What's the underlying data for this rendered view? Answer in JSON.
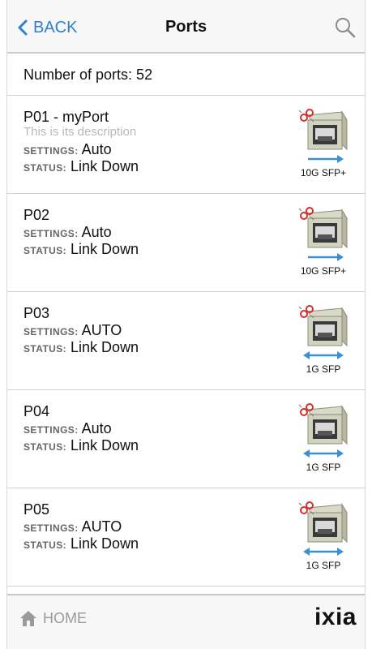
{
  "header": {
    "back_label": "BACK",
    "title": "Ports"
  },
  "summary": {
    "count_text": "Number of ports: 52"
  },
  "ports": [
    {
      "name": "P01 - myPort",
      "description": "This is its description",
      "settings_label": "SETTINGS:",
      "settings": "Auto",
      "status_label": "STATUS:",
      "status": "Link Down",
      "type": "10G SFP+"
    },
    {
      "name": "P02",
      "description": "",
      "settings_label": "SETTINGS:",
      "settings": "Auto",
      "status_label": "STATUS:",
      "status": "Link Down",
      "type": "10G SFP+"
    },
    {
      "name": "P03",
      "description": "",
      "settings_label": "SETTINGS:",
      "settings": "AUTO",
      "status_label": "STATUS:",
      "status": "Link Down",
      "type": "1G SFP"
    },
    {
      "name": "P04",
      "description": "",
      "settings_label": "SETTINGS:",
      "settings": "Auto",
      "status_label": "STATUS:",
      "status": "Link Down",
      "type": "1G SFP"
    },
    {
      "name": "P05",
      "description": "",
      "settings_label": "SETTINGS:",
      "settings": "AUTO",
      "status_label": "STATUS:",
      "status": "Link Down",
      "type": "1G SFP"
    }
  ],
  "footer": {
    "home_label": "HOME",
    "logo_text": "ixia"
  },
  "colors": {
    "accent": "#2f80d1",
    "arrow": "#3a8fd6",
    "unlink": "#d0312d"
  }
}
